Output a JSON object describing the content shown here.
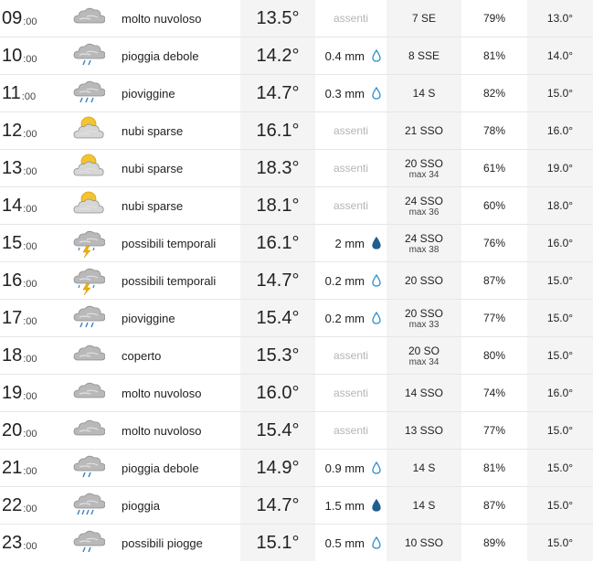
{
  "rows": [
    {
      "hour": "09",
      "min": ":00",
      "icon": "cloudy-icon",
      "desc": "molto nuvoloso",
      "temp": "13.5°",
      "rain": "assenti",
      "rain_absent": true,
      "wind": "7 SE",
      "wind_max": "",
      "humidity": "79%",
      "perceived": "13.0°"
    },
    {
      "hour": "10",
      "min": ":00",
      "icon": "light-rain-icon",
      "desc": "pioggia debole",
      "temp": "14.2°",
      "rain": "0.4 mm",
      "rain_absent": false,
      "drop": "light",
      "wind": "8 SSE",
      "wind_max": "",
      "humidity": "81%",
      "perceived": "14.0°"
    },
    {
      "hour": "11",
      "min": ":00",
      "icon": "drizzle-icon",
      "desc": "pioviggine",
      "temp": "14.7°",
      "rain": "0.3 mm",
      "rain_absent": false,
      "drop": "light",
      "wind": "14 S",
      "wind_max": "",
      "humidity": "82%",
      "perceived": "15.0°"
    },
    {
      "hour": "12",
      "min": ":00",
      "icon": "sun-cloud-icon",
      "desc": "nubi sparse",
      "temp": "16.1°",
      "rain": "assenti",
      "rain_absent": true,
      "wind": "21 SSO",
      "wind_max": "",
      "humidity": "78%",
      "perceived": "16.0°"
    },
    {
      "hour": "13",
      "min": ":00",
      "icon": "sun-cloud-icon",
      "desc": "nubi sparse",
      "temp": "18.3°",
      "rain": "assenti",
      "rain_absent": true,
      "wind": "20 SSO",
      "wind_max": "max 34",
      "humidity": "61%",
      "perceived": "19.0°"
    },
    {
      "hour": "14",
      "min": ":00",
      "icon": "sun-cloud-icon",
      "desc": "nubi sparse",
      "temp": "18.1°",
      "rain": "assenti",
      "rain_absent": true,
      "wind": "24 SSO",
      "wind_max": "max 36",
      "humidity": "60%",
      "perceived": "18.0°"
    },
    {
      "hour": "15",
      "min": ":00",
      "icon": "thunderstorm-icon",
      "desc": "possibili temporali",
      "temp": "16.1°",
      "rain": "2 mm",
      "rain_absent": false,
      "drop": "dark",
      "wind": "24 SSO",
      "wind_max": "max 38",
      "humidity": "76%",
      "perceived": "16.0°"
    },
    {
      "hour": "16",
      "min": ":00",
      "icon": "thunderstorm-icon",
      "desc": "possibili temporali",
      "temp": "14.7°",
      "rain": "0.2 mm",
      "rain_absent": false,
      "drop": "light",
      "wind": "20 SSO",
      "wind_max": "",
      "humidity": "87%",
      "perceived": "15.0°"
    },
    {
      "hour": "17",
      "min": ":00",
      "icon": "drizzle-icon",
      "desc": "pioviggine",
      "temp": "15.4°",
      "rain": "0.2 mm",
      "rain_absent": false,
      "drop": "light",
      "wind": "20 SSO",
      "wind_max": "max 33",
      "humidity": "77%",
      "perceived": "15.0°"
    },
    {
      "hour": "18",
      "min": ":00",
      "icon": "overcast-icon",
      "desc": "coperto",
      "temp": "15.3°",
      "rain": "assenti",
      "rain_absent": true,
      "wind": "20 SO",
      "wind_max": "max 34",
      "humidity": "80%",
      "perceived": "15.0°"
    },
    {
      "hour": "19",
      "min": ":00",
      "icon": "cloudy-icon",
      "desc": "molto nuvoloso",
      "temp": "16.0°",
      "rain": "assenti",
      "rain_absent": true,
      "wind": "14 SSO",
      "wind_max": "",
      "humidity": "74%",
      "perceived": "16.0°"
    },
    {
      "hour": "20",
      "min": ":00",
      "icon": "cloudy-icon",
      "desc": "molto nuvoloso",
      "temp": "15.4°",
      "rain": "assenti",
      "rain_absent": true,
      "wind": "13 SSO",
      "wind_max": "",
      "humidity": "77%",
      "perceived": "15.0°"
    },
    {
      "hour": "21",
      "min": ":00",
      "icon": "light-rain-icon",
      "desc": "pioggia debole",
      "temp": "14.9°",
      "rain": "0.9 mm",
      "rain_absent": false,
      "drop": "light",
      "wind": "14 S",
      "wind_max": "",
      "humidity": "81%",
      "perceived": "15.0°"
    },
    {
      "hour": "22",
      "min": ":00",
      "icon": "rain-icon",
      "desc": "pioggia",
      "temp": "14.7°",
      "rain": "1.5 mm",
      "rain_absent": false,
      "drop": "dark",
      "wind": "14 S",
      "wind_max": "",
      "humidity": "87%",
      "perceived": "15.0°"
    },
    {
      "hour": "23",
      "min": ":00",
      "icon": "light-rain-icon",
      "desc": "possibili piogge",
      "temp": "15.1°",
      "rain": "0.5 mm",
      "rain_absent": false,
      "drop": "light",
      "wind": "10 SSO",
      "wind_max": "",
      "humidity": "89%",
      "perceived": "15.0°"
    }
  ],
  "colors": {
    "drop_light": "#2f8fd0",
    "drop_dark": "#1f5f8f",
    "cloud": "#b9b9b9",
    "sun": "#f3c332",
    "rain": "#3a7fc0",
    "bolt": "#f0b000"
  }
}
